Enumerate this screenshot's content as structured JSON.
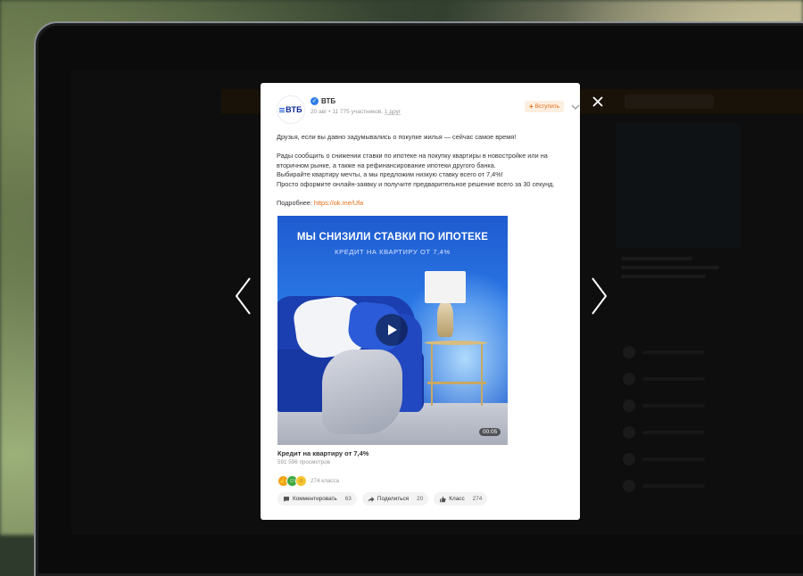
{
  "post": {
    "author": "ВТБ",
    "avatar_text": "ВТБ",
    "meta_date_members": "20 авг • 11 775 участников, ",
    "meta_friends": "1 друг",
    "join_label": "Вступить",
    "text_lines": [
      "Друзья, если вы давно задумывались о покупке жилья — сейчас самое время!",
      "",
      "Рады сообщить о снижении ставки по ипотеке на покупку квартиры в новостройке или на",
      "вторичном рынке, а также на рефинансирование ипотеки другого банка.",
      "Выбирайте квартиру мечты, а мы предложим низкую ставку всего от 7,4%!",
      "Просто оформите онлайн-заявку и получите предварительное решение всего за 30 секунд.",
      ""
    ],
    "more_prefix": "Подробнее: ",
    "more_link": "https://ok.me/Ufa"
  },
  "video": {
    "headline": "МЫ СНИЗИЛИ СТАВКИ ПО ИПОТЕКЕ",
    "subheadline": "КРЕДИТ НА КВАРТИРУ ОТ 7,4%",
    "duration": "00:05",
    "caption": "Кредит на квартиру от 7,4%",
    "views": "591 596 просмотров"
  },
  "reactions": {
    "icons": [
      "like-icon",
      "laugh-icon",
      "wow-icon"
    ],
    "count_label": "274 класса"
  },
  "actions": {
    "comment_label": "Комментировать",
    "comment_count": "63",
    "share_label": "Поделиться",
    "share_count": "20",
    "class_label": "Класс",
    "class_count": "274"
  },
  "colors": {
    "accent": "#e56c12",
    "brand": "#0a2896",
    "video_bg": "#2a78e6"
  }
}
